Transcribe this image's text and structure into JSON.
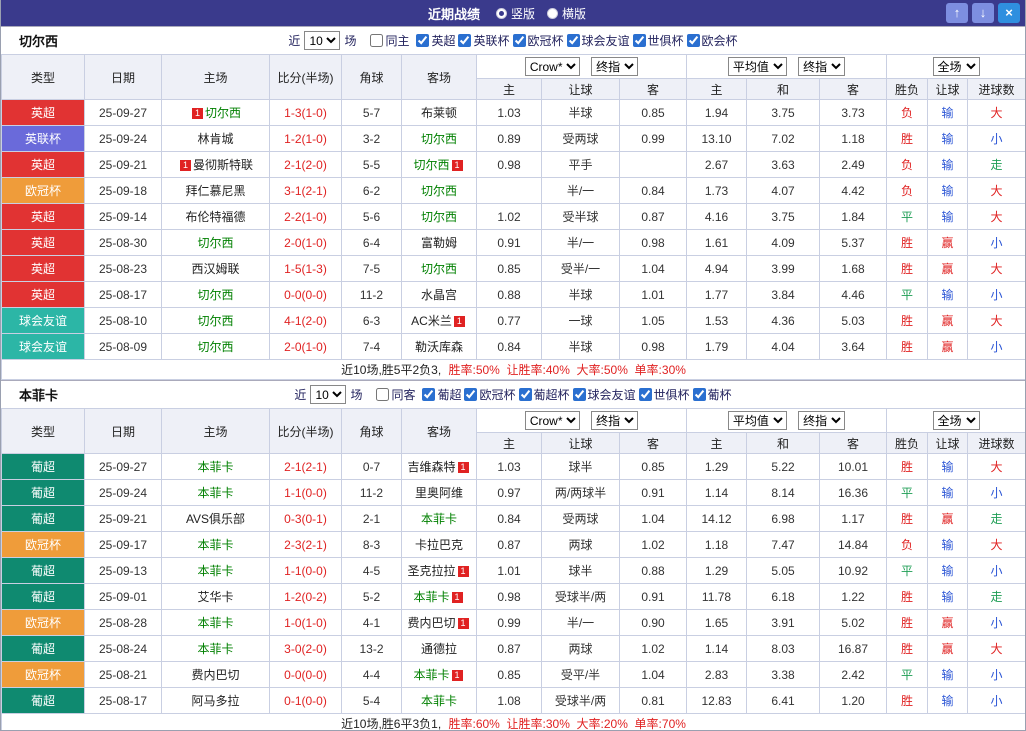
{
  "titlebar": {
    "title": "近期战绩",
    "layout_options": {
      "vertical": "竖版",
      "horizontal": "横版",
      "selected": "竖版"
    },
    "up_icon": "↑",
    "down_icon": "↓",
    "close_icon": "×"
  },
  "colors": {
    "titlebar_bg": "#3a3a8c",
    "header_bg": "#eef0f7",
    "score": "#e02222",
    "focus_team": "#008000",
    "badge": "#e02222"
  },
  "type_colors": {
    "英超": "#e13333",
    "英联杯": "#6a6ada",
    "欧冠杯": "#ef9c3a",
    "球会友谊": "#2cb6a6",
    "葡超": "#0f8a70"
  },
  "verdict_colors": {
    "胜": "#e02222",
    "平": "#1f9e55",
    "负": "#e02222",
    "赢": "#e02222",
    "输": "#2b55d5",
    "大": "#e02222",
    "小": "#2b55d5",
    "走": "#1f9e55"
  },
  "sections": [
    {
      "team": "切尔西",
      "filter": {
        "near_label": "近",
        "count": "10",
        "games_label": "场",
        "venue_label": "同主",
        "venue_checked": false,
        "leagues": [
          {
            "label": "英超",
            "checked": true
          },
          {
            "label": "英联杯",
            "checked": true
          },
          {
            "label": "欧冠杯",
            "checked": true
          },
          {
            "label": "球会友谊",
            "checked": true
          },
          {
            "label": "世俱杯",
            "checked": true
          },
          {
            "label": "欧会杯",
            "checked": true
          }
        ]
      },
      "controls": {
        "book": "Crow*",
        "book_stage": "终指",
        "avg": "平均值",
        "avg_stage": "终指",
        "scope": "全场"
      },
      "headers": [
        "类型",
        "日期",
        "主场",
        "比分(半场)",
        "角球",
        "客场",
        "主",
        "让球",
        "客",
        "主",
        "和",
        "客",
        "胜负",
        "让球",
        "进球数"
      ],
      "rows": [
        {
          "league": "英超",
          "date": "25-09-27",
          "home": {
            "name": "切尔西",
            "focus": true,
            "badge_left": "1"
          },
          "score": "1-3(1-0)",
          "corners": "5-7",
          "away": {
            "name": "布莱顿"
          },
          "odds": [
            "1.03",
            "半球",
            "0.85",
            "1.94",
            "3.75",
            "3.73"
          ],
          "verdicts": [
            "负",
            "输",
            "大"
          ]
        },
        {
          "league": "英联杯",
          "date": "25-09-24",
          "home": {
            "name": "林肯城"
          },
          "score": "1-2(1-0)",
          "corners": "3-2",
          "away": {
            "name": "切尔西",
            "focus": true
          },
          "odds": [
            "0.89",
            "受两球",
            "0.99",
            "13.10",
            "7.02",
            "1.18"
          ],
          "verdicts": [
            "胜",
            "输",
            "小"
          ]
        },
        {
          "league": "英超",
          "date": "25-09-21",
          "home": {
            "name": "曼彻斯特联",
            "badge_left": "1"
          },
          "score": "2-1(2-0)",
          "corners": "5-5",
          "away": {
            "name": "切尔西",
            "focus": true,
            "badge_right": "1"
          },
          "odds": [
            "0.98",
            "平手",
            "",
            "2.67",
            "3.63",
            "2.49"
          ],
          "verdicts": [
            "负",
            "输",
            "走"
          ]
        },
        {
          "league": "欧冠杯",
          "date": "25-09-18",
          "home": {
            "name": "拜仁慕尼黑"
          },
          "score": "3-1(2-1)",
          "corners": "6-2",
          "away": {
            "name": "切尔西",
            "focus": true
          },
          "odds": [
            "",
            "半/一",
            "0.84",
            "1.73",
            "4.07",
            "4.42"
          ],
          "verdicts": [
            "负",
            "输",
            "大"
          ]
        },
        {
          "league": "英超",
          "date": "25-09-14",
          "home": {
            "name": "布伦特福德"
          },
          "score": "2-2(1-0)",
          "corners": "5-6",
          "away": {
            "name": "切尔西",
            "focus": true
          },
          "odds": [
            "1.02",
            "受半球",
            "0.87",
            "4.16",
            "3.75",
            "1.84"
          ],
          "verdicts": [
            "平",
            "输",
            "大"
          ]
        },
        {
          "league": "英超",
          "date": "25-08-30",
          "home": {
            "name": "切尔西",
            "focus": true
          },
          "score": "2-0(1-0)",
          "corners": "6-4",
          "away": {
            "name": "富勒姆"
          },
          "odds": [
            "0.91",
            "半/一",
            "0.98",
            "1.61",
            "4.09",
            "5.37"
          ],
          "verdicts": [
            "胜",
            "赢",
            "小"
          ]
        },
        {
          "league": "英超",
          "date": "25-08-23",
          "home": {
            "name": "西汉姆联"
          },
          "score": "1-5(1-3)",
          "corners": "7-5",
          "away": {
            "name": "切尔西",
            "focus": true
          },
          "odds": [
            "0.85",
            "受半/一",
            "1.04",
            "4.94",
            "3.99",
            "1.68"
          ],
          "verdicts": [
            "胜",
            "赢",
            "大"
          ]
        },
        {
          "league": "英超",
          "date": "25-08-17",
          "home": {
            "name": "切尔西",
            "focus": true
          },
          "score": "0-0(0-0)",
          "corners": "11-2",
          "away": {
            "name": "水晶宫"
          },
          "odds": [
            "0.88",
            "半球",
            "1.01",
            "1.77",
            "3.84",
            "4.46"
          ],
          "verdicts": [
            "平",
            "输",
            "小"
          ]
        },
        {
          "league": "球会友谊",
          "date": "25-08-10",
          "home": {
            "name": "切尔西",
            "focus": true
          },
          "score": "4-1(2-0)",
          "corners": "6-3",
          "away": {
            "name": "AC米兰",
            "badge_right": "1"
          },
          "odds": [
            "0.77",
            "一球",
            "1.05",
            "1.53",
            "4.36",
            "5.03"
          ],
          "verdicts": [
            "胜",
            "赢",
            "大"
          ]
        },
        {
          "league": "球会友谊",
          "date": "25-08-09",
          "home": {
            "name": "切尔西",
            "focus": true
          },
          "score": "2-0(1-0)",
          "corners": "7-4",
          "away": {
            "name": "勒沃库森"
          },
          "odds": [
            "0.84",
            "半球",
            "0.98",
            "1.79",
            "4.04",
            "3.64"
          ],
          "verdicts": [
            "胜",
            "赢",
            "小"
          ]
        }
      ],
      "summary": {
        "prefix": "近10场,胜5平2负3,",
        "stats": "胜率:50%  让胜率:40%  大率:50%  单率:30%"
      }
    },
    {
      "team": "本菲卡",
      "filter": {
        "near_label": "近",
        "count": "10",
        "games_label": "场",
        "venue_label": "同客",
        "venue_checked": false,
        "leagues": [
          {
            "label": "葡超",
            "checked": true
          },
          {
            "label": "欧冠杯",
            "checked": true
          },
          {
            "label": "葡超杯",
            "checked": true
          },
          {
            "label": "球会友谊",
            "checked": true
          },
          {
            "label": "世俱杯",
            "checked": true
          },
          {
            "label": "葡杯",
            "checked": true
          }
        ]
      },
      "controls": {
        "book": "Crow*",
        "book_stage": "终指",
        "avg": "平均值",
        "avg_stage": "终指",
        "scope": "全场"
      },
      "headers": [
        "类型",
        "日期",
        "主场",
        "比分(半场)",
        "角球",
        "客场",
        "主",
        "让球",
        "客",
        "主",
        "和",
        "客",
        "胜负",
        "让球",
        "进球数"
      ],
      "rows": [
        {
          "league": "葡超",
          "date": "25-09-27",
          "home": {
            "name": "本菲卡",
            "focus": true
          },
          "score": "2-1(2-1)",
          "corners": "0-7",
          "away": {
            "name": "吉维森特",
            "badge_right": "1"
          },
          "odds": [
            "1.03",
            "球半",
            "0.85",
            "1.29",
            "5.22",
            "10.01"
          ],
          "verdicts": [
            "胜",
            "输",
            "大"
          ]
        },
        {
          "league": "葡超",
          "date": "25-09-24",
          "home": {
            "name": "本菲卡",
            "focus": true
          },
          "score": "1-1(0-0)",
          "corners": "11-2",
          "away": {
            "name": "里奥阿维"
          },
          "odds": [
            "0.97",
            "两/两球半",
            "0.91",
            "1.14",
            "8.14",
            "16.36"
          ],
          "verdicts": [
            "平",
            "输",
            "小"
          ]
        },
        {
          "league": "葡超",
          "date": "25-09-21",
          "home": {
            "name": "AVS俱乐部"
          },
          "score": "0-3(0-1)",
          "corners": "2-1",
          "away": {
            "name": "本菲卡",
            "focus": true
          },
          "odds": [
            "0.84",
            "受两球",
            "1.04",
            "14.12",
            "6.98",
            "1.17"
          ],
          "verdicts": [
            "胜",
            "赢",
            "走"
          ]
        },
        {
          "league": "欧冠杯",
          "date": "25-09-17",
          "home": {
            "name": "本菲卡",
            "focus": true
          },
          "score": "2-3(2-1)",
          "corners": "8-3",
          "away": {
            "name": "卡拉巴克"
          },
          "odds": [
            "0.87",
            "两球",
            "1.02",
            "1.18",
            "7.47",
            "14.84"
          ],
          "verdicts": [
            "负",
            "输",
            "大"
          ]
        },
        {
          "league": "葡超",
          "date": "25-09-13",
          "home": {
            "name": "本菲卡",
            "focus": true
          },
          "score": "1-1(0-0)",
          "corners": "4-5",
          "away": {
            "name": "圣克拉拉",
            "badge_right": "1"
          },
          "odds": [
            "1.01",
            "球半",
            "0.88",
            "1.29",
            "5.05",
            "10.92"
          ],
          "verdicts": [
            "平",
            "输",
            "小"
          ]
        },
        {
          "league": "葡超",
          "date": "25-09-01",
          "home": {
            "name": "艾华卡"
          },
          "score": "1-2(0-2)",
          "corners": "5-2",
          "away": {
            "name": "本菲卡",
            "focus": true,
            "badge_right": "1"
          },
          "odds": [
            "0.98",
            "受球半/两",
            "0.91",
            "11.78",
            "6.18",
            "1.22"
          ],
          "verdicts": [
            "胜",
            "输",
            "走"
          ]
        },
        {
          "league": "欧冠杯",
          "date": "25-08-28",
          "home": {
            "name": "本菲卡",
            "focus": true
          },
          "score": "1-0(1-0)",
          "corners": "4-1",
          "away": {
            "name": "费内巴切",
            "badge_right": "1"
          },
          "odds": [
            "0.99",
            "半/一",
            "0.90",
            "1.65",
            "3.91",
            "5.02"
          ],
          "verdicts": [
            "胜",
            "赢",
            "小"
          ]
        },
        {
          "league": "葡超",
          "date": "25-08-24",
          "home": {
            "name": "本菲卡",
            "focus": true
          },
          "score": "3-0(2-0)",
          "corners": "13-2",
          "away": {
            "name": "通德拉"
          },
          "odds": [
            "0.87",
            "两球",
            "1.02",
            "1.14",
            "8.03",
            "16.87"
          ],
          "verdicts": [
            "胜",
            "赢",
            "大"
          ]
        },
        {
          "league": "欧冠杯",
          "date": "25-08-21",
          "home": {
            "name": "费内巴切"
          },
          "score": "0-0(0-0)",
          "corners": "4-4",
          "away": {
            "name": "本菲卡",
            "focus": true,
            "badge_right": "1"
          },
          "odds": [
            "0.85",
            "受平/半",
            "1.04",
            "2.83",
            "3.38",
            "2.42"
          ],
          "verdicts": [
            "平",
            "输",
            "小"
          ]
        },
        {
          "league": "葡超",
          "date": "25-08-17",
          "home": {
            "name": "阿马多拉"
          },
          "score": "0-1(0-0)",
          "corners": "5-4",
          "away": {
            "name": "本菲卡",
            "focus": true
          },
          "odds": [
            "1.08",
            "受球半/两",
            "0.81",
            "12.83",
            "6.41",
            "1.20"
          ],
          "verdicts": [
            "胜",
            "输",
            "小"
          ]
        }
      ],
      "summary": {
        "prefix": "近10场,胜6平3负1,",
        "stats": "胜率:60%  让胜率:30%  大率:20%  单率:70%"
      }
    }
  ]
}
